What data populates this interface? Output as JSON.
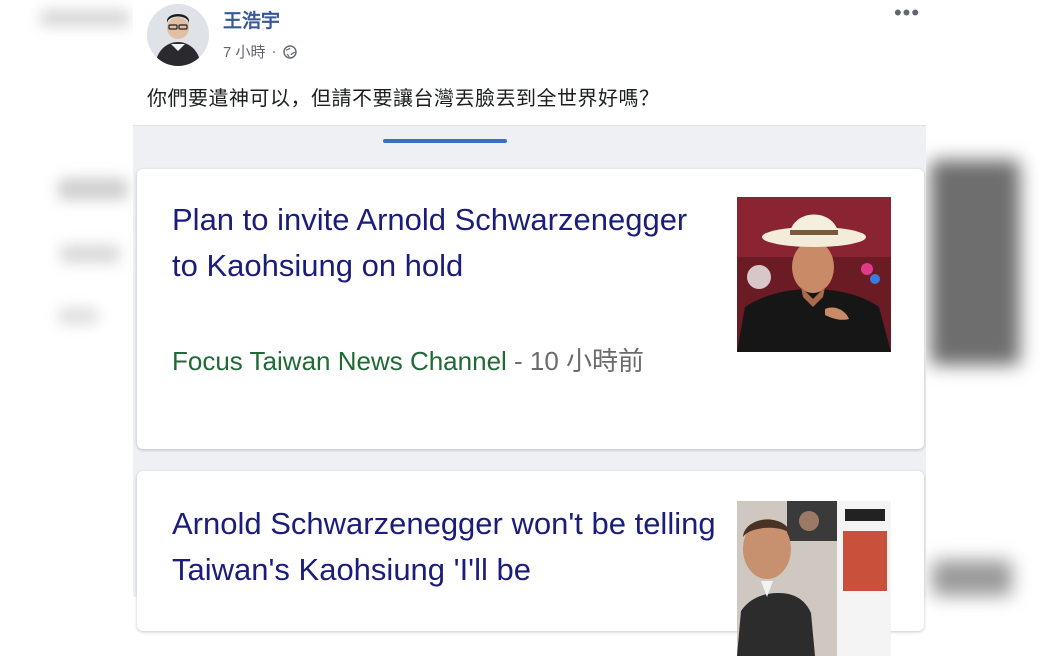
{
  "post": {
    "author": "王浩宇",
    "time": "7 小時",
    "separator": "·",
    "text": "你們要遣神可以，但請不要讓台灣丟臉丟到全世界好嗎？",
    "more_glyph": "•••"
  },
  "news_cards": [
    {
      "headline": "Plan to invite Arnold Schwarzenegger to Kaohsiung on hold",
      "source": "Focus Taiwan News Channel",
      "age": " - 10 小時前"
    },
    {
      "headline": "Arnold Schwarzenegger won't be telling Taiwan's Kaohsiung 'I'll be"
    }
  ],
  "icons": {
    "globe": "globe-icon",
    "more": "more-options-icon"
  },
  "colors": {
    "name_link": "#385898",
    "headline": "#1a1d7a",
    "source": "#1e6b35",
    "tab_indicator": "#3b6fc1"
  }
}
